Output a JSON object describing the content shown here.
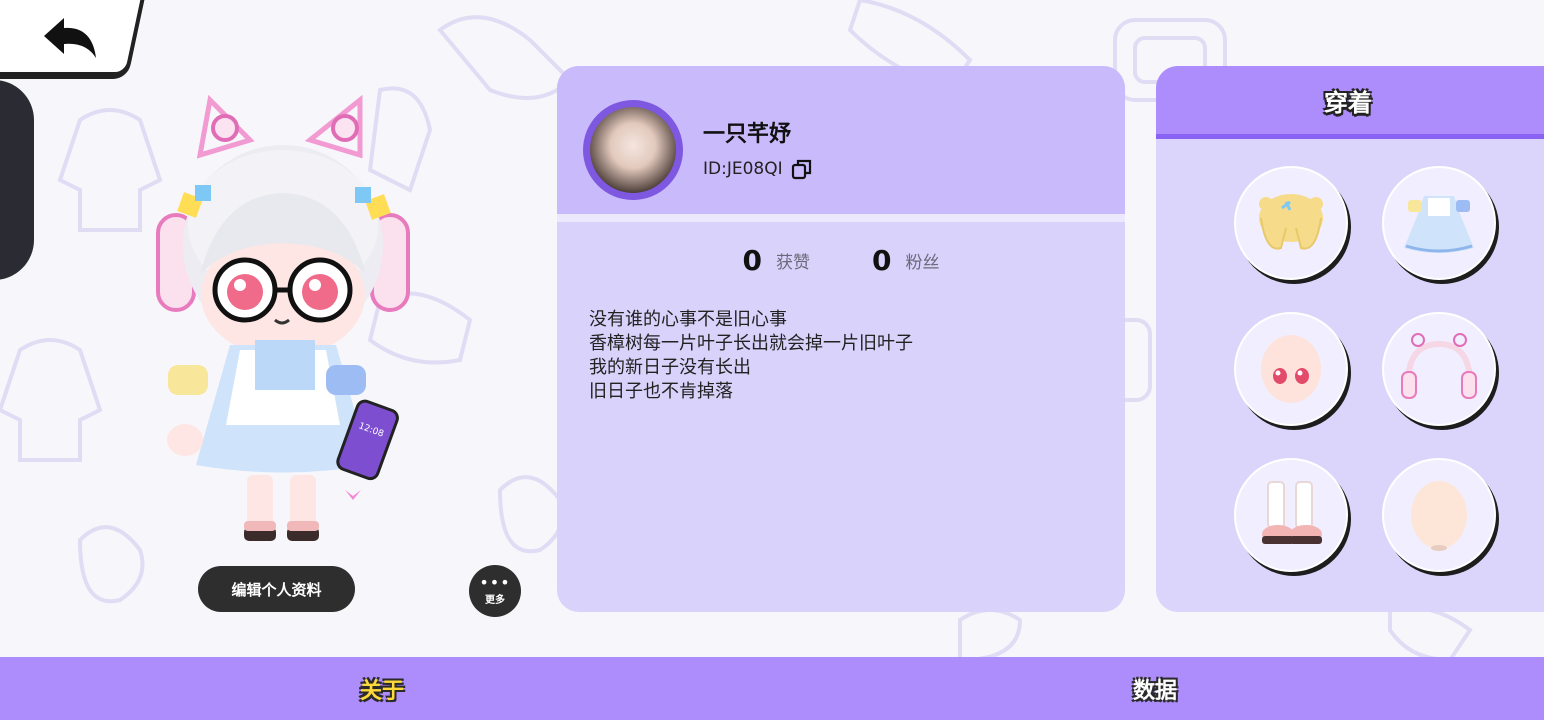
{
  "profile": {
    "username": "一只芊妤",
    "user_id": "ID:JE08QI",
    "stats": [
      {
        "value": "0",
        "label": "获赞"
      },
      {
        "value": "0",
        "label": "粉丝"
      }
    ],
    "bio": [
      "没有谁的心事不是旧心事",
      "香樟树每一片叶子长出就会掉一片旧叶子",
      "我的新日子没有长出",
      "旧日子也不肯掉落"
    ]
  },
  "actions": {
    "edit_label": "编辑个人资料",
    "more_label": "更多",
    "more_dots": "•••"
  },
  "avatar": {
    "phone_time": "12:08"
  },
  "wearing": {
    "title": "穿着",
    "items": [
      {
        "icon": "hair-icon"
      },
      {
        "icon": "dress-icon"
      },
      {
        "icon": "face-icon"
      },
      {
        "icon": "headphones-icon"
      },
      {
        "icon": "shoes-icon"
      },
      {
        "icon": "head-base-icon"
      }
    ]
  },
  "tabs": {
    "about": "关于",
    "data": "数据"
  },
  "colors": {
    "accent": "#ad8cfb",
    "card": "#d9d2fb",
    "active_tab": "#ffd83a"
  }
}
